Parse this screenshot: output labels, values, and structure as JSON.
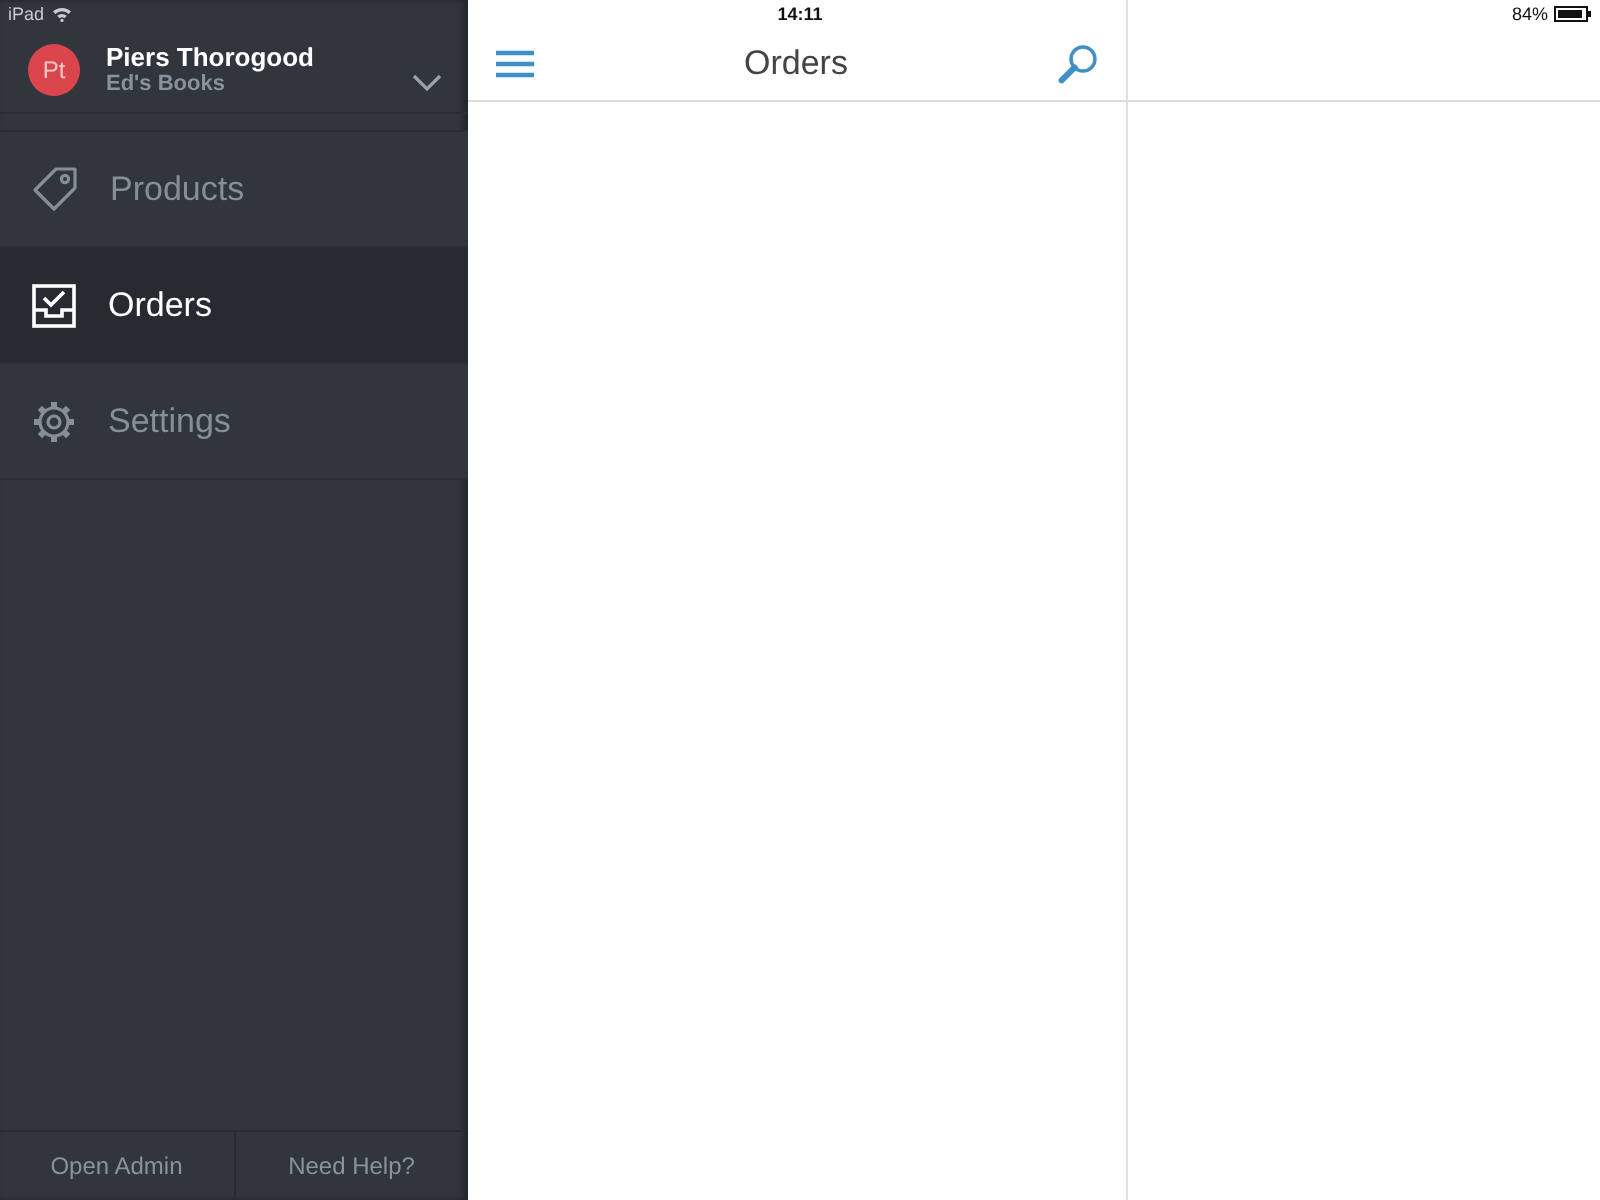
{
  "status_bar": {
    "device": "iPad",
    "time": "14:11",
    "battery": "84%"
  },
  "account": {
    "initials": "Pt",
    "name": "Piers Thorogood",
    "store": "Ed's Books"
  },
  "sidebar": {
    "items": [
      {
        "label": "Products",
        "kind": "tag",
        "selected": false
      },
      {
        "label": "Orders",
        "kind": "orders",
        "selected": true
      },
      {
        "label": "Settings",
        "kind": "settings",
        "selected": false
      }
    ]
  },
  "footer_links": [
    "Open Admin",
    "Need Help?"
  ],
  "main": {
    "title": "Orders"
  }
}
